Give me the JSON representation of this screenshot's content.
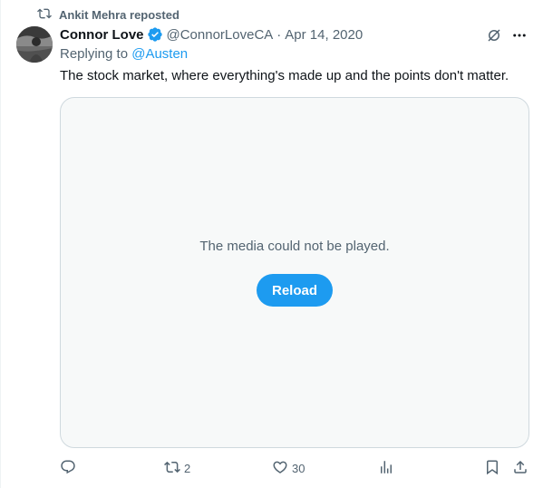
{
  "repost": {
    "icon": "repost-icon",
    "label": "Ankit Mehra reposted"
  },
  "tweet": {
    "author_name": "Connor Love",
    "verified": true,
    "handle": "@ConnorLoveCA",
    "separator": "·",
    "date": "Apr 14, 2020",
    "replying_prefix": "Replying to",
    "replying_to": "@Austen",
    "text": "The stock market, where everything's made up and the points don't matter."
  },
  "media": {
    "error_message": "The media could not be played.",
    "reload_label": "Reload"
  },
  "actions": {
    "reply_count": "",
    "repost_count": "2",
    "like_count": "30",
    "views_count": ""
  },
  "colors": {
    "accent": "#1d9bf0",
    "muted": "#536471",
    "text": "#0f1419"
  }
}
